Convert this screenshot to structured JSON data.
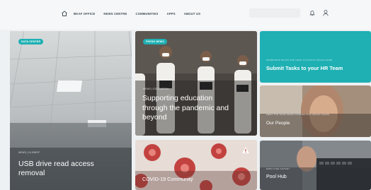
{
  "nav": {
    "items": [
      "BKAF OFFICE",
      "NEWS CENTRE",
      "COMMUNITIES",
      "APPS",
      "ABOUT US"
    ]
  },
  "tiles": {
    "office": {
      "badge": "DATA CENTER",
      "meta": "NEWS | IN BRIEF",
      "title": "USB drive read access removal"
    },
    "education": {
      "badge": "FRESH NEWS",
      "meta": "NEWS | EDUCATION",
      "title": "Supporting education through the pandemic and beyond"
    },
    "submit": {
      "meta": "WORKSHOP HELPS THE TEAM TO FOCUS THINGS DONE",
      "title": "Submit Tasks to your HR Team"
    },
    "people": {
      "meta": "MEET THE TEAM LEADS CONNECTING CROSS TEAMS",
      "title": "Our People"
    },
    "covid": {
      "title": "COVID-19 Community"
    },
    "pool": {
      "meta": "EMPLOYEE SURVEY",
      "title": "Pool Hub"
    }
  },
  "colors": {
    "accent": "#1fb0b3",
    "header_bg": "#f6f7f8",
    "nav_text": "#3d4a55"
  },
  "icons": [
    "home-icon",
    "bell-icon",
    "user-icon",
    "alert-icon"
  ]
}
